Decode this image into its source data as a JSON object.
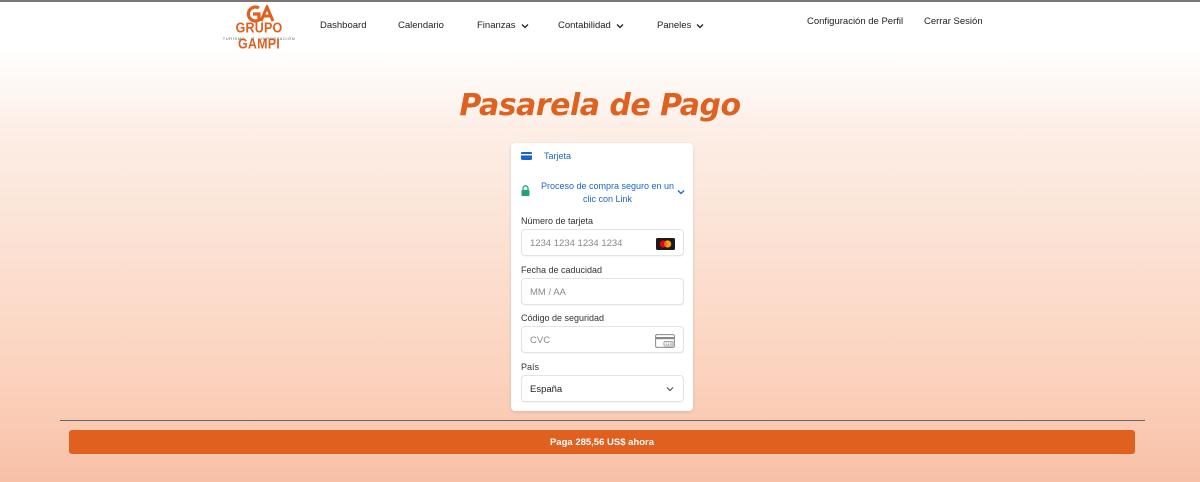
{
  "brand": {
    "name": "GRUPO GAMPI",
    "monogram": "GA",
    "tagline": "TURISMO · IT · IMPORTACIÓN",
    "color": "#e0601f"
  },
  "nav": {
    "dashboard": "Dashboard",
    "calendario": "Calendario",
    "finanzas": "Finanzas",
    "contabilidad": "Contabilidad",
    "paneles": "Paneles",
    "perfil": "Configuración de Perfil",
    "logout": "Cerrar Sesión"
  },
  "page": {
    "title": "Pasarela de Pago"
  },
  "payment": {
    "tab_label": "Tarjeta",
    "link_text": "Proceso de compra seguro en un clic con Link",
    "card_number": {
      "label": "Número de tarjeta",
      "placeholder": "1234 1234 1234 1234"
    },
    "expiry": {
      "label": "Fecha de caducidad",
      "placeholder": "MM / AA"
    },
    "cvc": {
      "label": "Código de seguridad",
      "placeholder": "CVC"
    },
    "country": {
      "label": "País",
      "value": "España"
    }
  },
  "pay_button": {
    "label": "Paga 285,56 US$ ahora"
  },
  "icons": {
    "tab": "credit-card-icon",
    "secure": "lock-icon",
    "expand": "chevron-down-icon",
    "brand": "mastercard-icon",
    "cvc": "cvc-card-icon"
  },
  "colors": {
    "accent": "#e0601f",
    "link": "#1a66c8",
    "secure": "#1ea672"
  }
}
